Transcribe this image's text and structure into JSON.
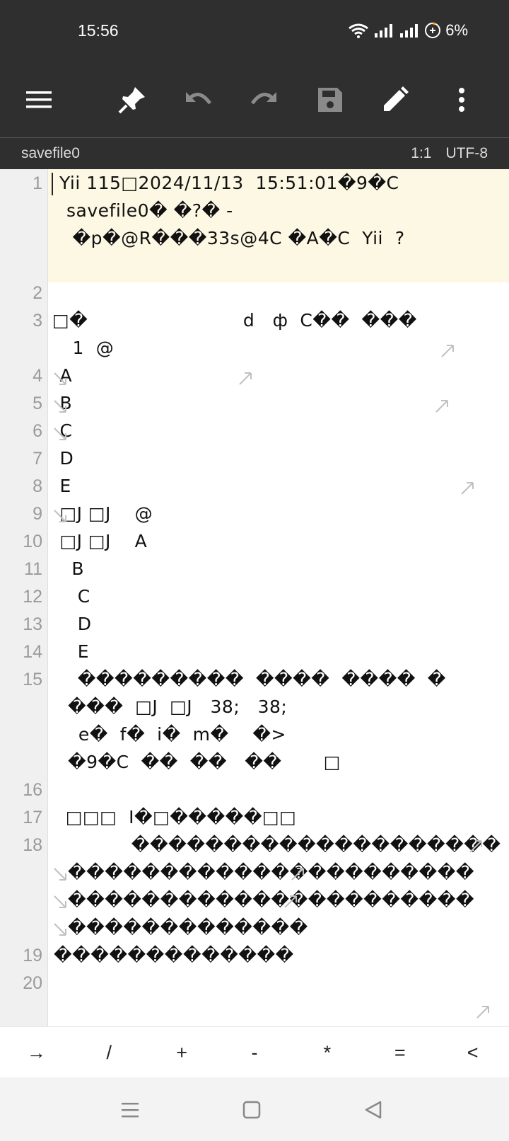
{
  "status": {
    "time": "15:56",
    "battery": "6%",
    "icons": [
      "wifi-icon",
      "signal-icon",
      "signal-icon",
      "battery-saver-icon"
    ]
  },
  "toolbar": {
    "icons": [
      "menu-icon",
      "pin-icon",
      "undo-icon",
      "redo-icon",
      "save-icon",
      "edit-icon",
      "more-icon"
    ]
  },
  "file": {
    "name": "savefile0",
    "position": "1:1",
    "encoding": "UTF-8"
  },
  "editor": {
    "line_numbers": [
      "1",
      "2",
      "3",
      "4",
      "5",
      "6",
      "7",
      "8",
      "9",
      "10",
      "11",
      "12",
      "13",
      "14",
      "15",
      "16",
      "17",
      "18",
      "19",
      "20"
    ],
    "rows": [
      "Yii 115□2024/11/13  15:51:01�9�C",
      "savefile0� �?� -",
      " �p�@R���33s@4C �A�C  Yii  ?",
      "",
      "",
      "□�                          d   ф  C��  ���",
      " 1  @",
      " A",
      " B",
      " C",
      " D",
      " E",
      " □J □J    @",
      " □J □J    A",
      "   B",
      "    C",
      "    D",
      "    E",
      "    ���������  ����  ����  �",
      "���  □J  □J   38;   38;",
      "  e�  f�  i�  m�    �>",
      "�9�C  ��  ��   ��       □",
      "",
      "  □□□  I�□�����□□",
      "             ��������������������",
      "����������������������",
      "����������������������",
      "�������������",
      "�������������",
      ""
    ]
  },
  "keys": [
    "→",
    "/",
    "+",
    "-",
    "*",
    "=",
    "<"
  ],
  "nav": {
    "icons": [
      "recent-apps-icon",
      "home-icon",
      "back-icon"
    ]
  },
  "colors": {
    "bar_bg": "#2f2f2f",
    "current_line": "#fdf8e4",
    "gutter": "#f0f0f0"
  }
}
